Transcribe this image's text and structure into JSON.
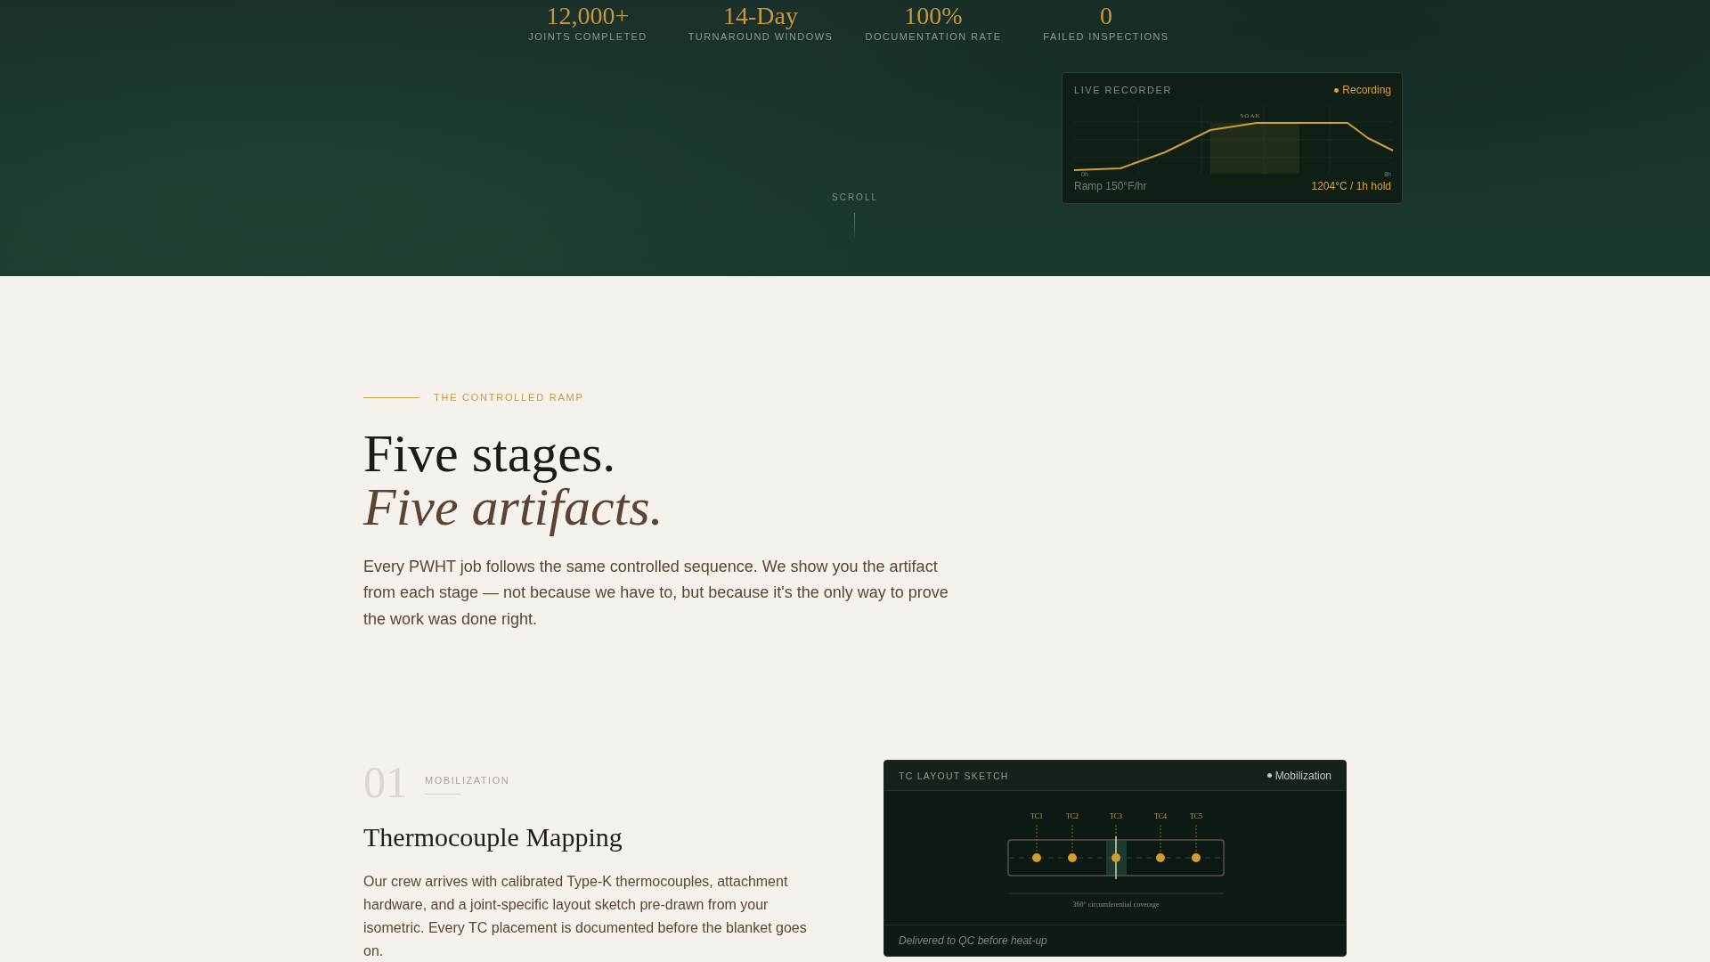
{
  "stats": [
    {
      "value": "12,000+",
      "label": "JOINTS COMPLETED"
    },
    {
      "value": "14-Day",
      "label": "TURNAROUND WINDOWS"
    },
    {
      "value": "100%",
      "label": "DOCUMENTATION RATE"
    },
    {
      "value": "0",
      "label": "FAILED INSPECTIONS"
    }
  ],
  "live_recorder": {
    "title": "LIVE RECORDER",
    "status": "Recording",
    "chart": {
      "phase_label": "SOAK",
      "start_label": "0h",
      "end_label": "8h"
    },
    "ramp": "Ramp 150°F/hr",
    "hold": "1204°C / 1h hold"
  },
  "scroll_hint": "SCROLL",
  "intro": {
    "eyebrow": "THE CONTROLLED RAMP",
    "heading": "Five stages.",
    "heading_accent": "Five artifacts.",
    "body": "Every PWHT job follows the same controlled sequence. We show you the artifact from each stage — not because we have to, but because it's the only way to prove the work was done right."
  },
  "stages": [
    {
      "number": "01",
      "name": "MOBILIZATION",
      "title": "Thermocouple Mapping",
      "body": "Our crew arrives with calibrated Type-K thermocouples, attachment hardware, and a joint-specific layout sketch pre-drawn from your isometric. Every TC placement is documented before the blanket goes on.",
      "artifact": {
        "title": "TC LAYOUT SKETCH",
        "status": "Mobilization",
        "thermocouples": [
          "TC1",
          "TC2",
          "TC3",
          "TC4",
          "TC5"
        ],
        "caption": "360° circumferential coverage",
        "footer": "Delivered to QC before heat-up"
      }
    }
  ]
}
